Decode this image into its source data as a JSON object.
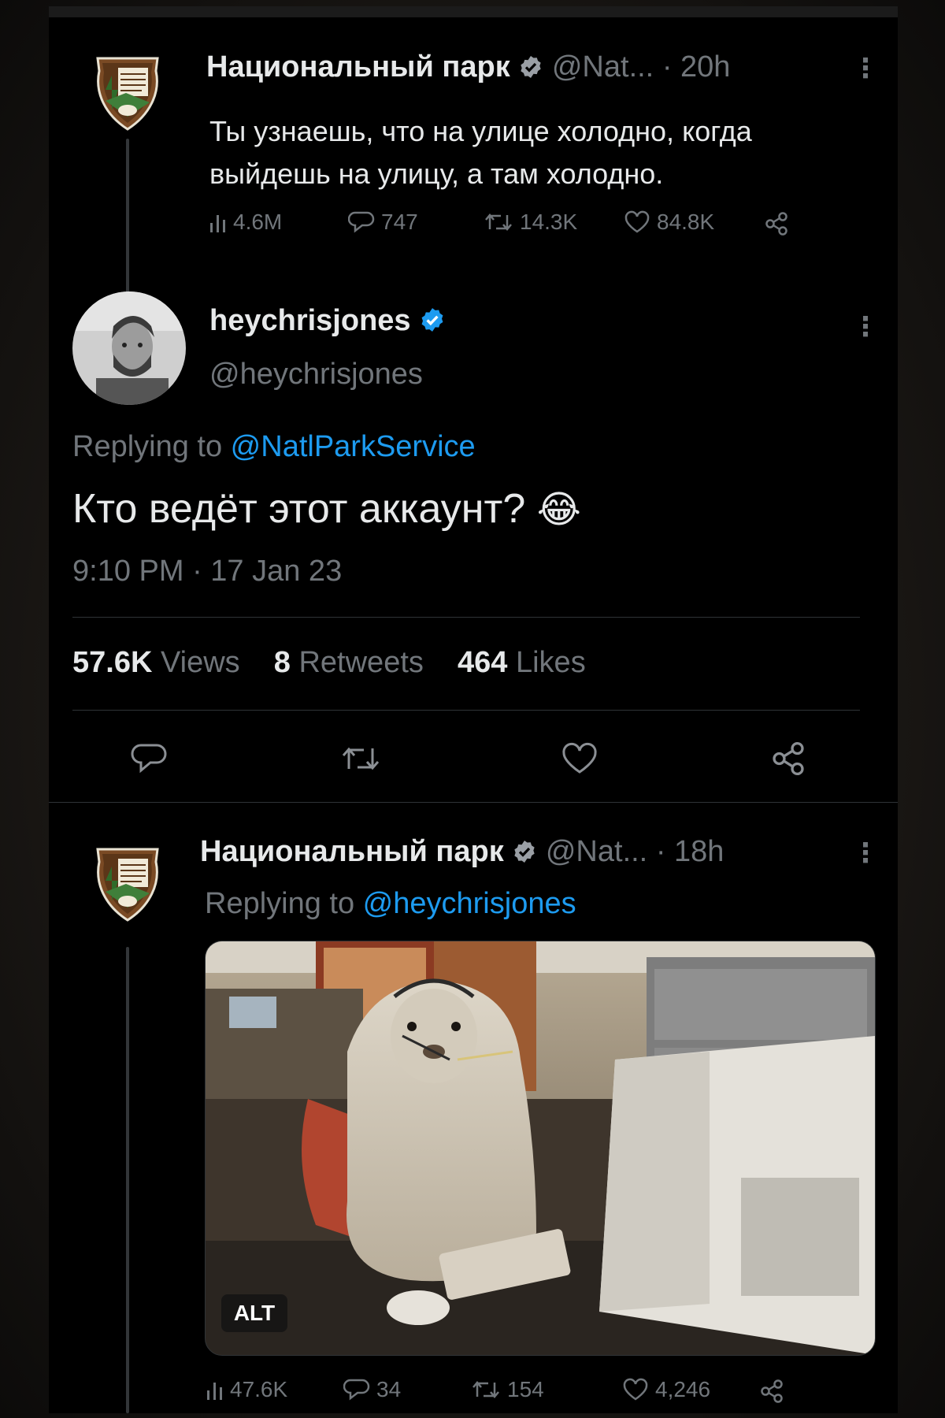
{
  "tweet1": {
    "name": "Национальный парк",
    "handle": "@Nat...",
    "time": "· 20h",
    "text_line1": "Ты узнаешь, что на улице холодно, когда",
    "text_line2": "выйдешь на улицу, а там холодно.",
    "views": "4.6M",
    "replies": "747",
    "retweets": "14.3K",
    "likes": "84.8K"
  },
  "reply": {
    "name": "heychrisjones",
    "handle": "@heychrisjones",
    "replying_prefix": "Replying to ",
    "replying_to": "@NatlParkService",
    "text": "Кто ведёт этот аккаунт?",
    "emoji": "😂",
    "timestamp": "9:10 PM · 17 Jan 23",
    "views_count": "57.6K",
    "views_label": "Views",
    "retweets_count": "8",
    "retweets_label": "Retweets",
    "likes_count": "464",
    "likes_label": "Likes"
  },
  "tweet3": {
    "name": "Национальный парк",
    "handle": "@Nat...",
    "time": "· 18h",
    "replying_prefix": "Replying to ",
    "replying_to": "@heychrisjones",
    "alt_label": "ALT",
    "views": "47.6K",
    "replies": "34",
    "retweets": "154",
    "likes": "4,246"
  },
  "colors": {
    "background": "#000000",
    "text": "#e7e9ea",
    "muted": "#71767b",
    "accent": "#1d9bf0",
    "badge_brown": "#8a5a2b"
  },
  "icons": [
    "views-icon",
    "reply-icon",
    "retweet-icon",
    "like-icon",
    "share-icon",
    "verified-icon",
    "more-icon"
  ]
}
